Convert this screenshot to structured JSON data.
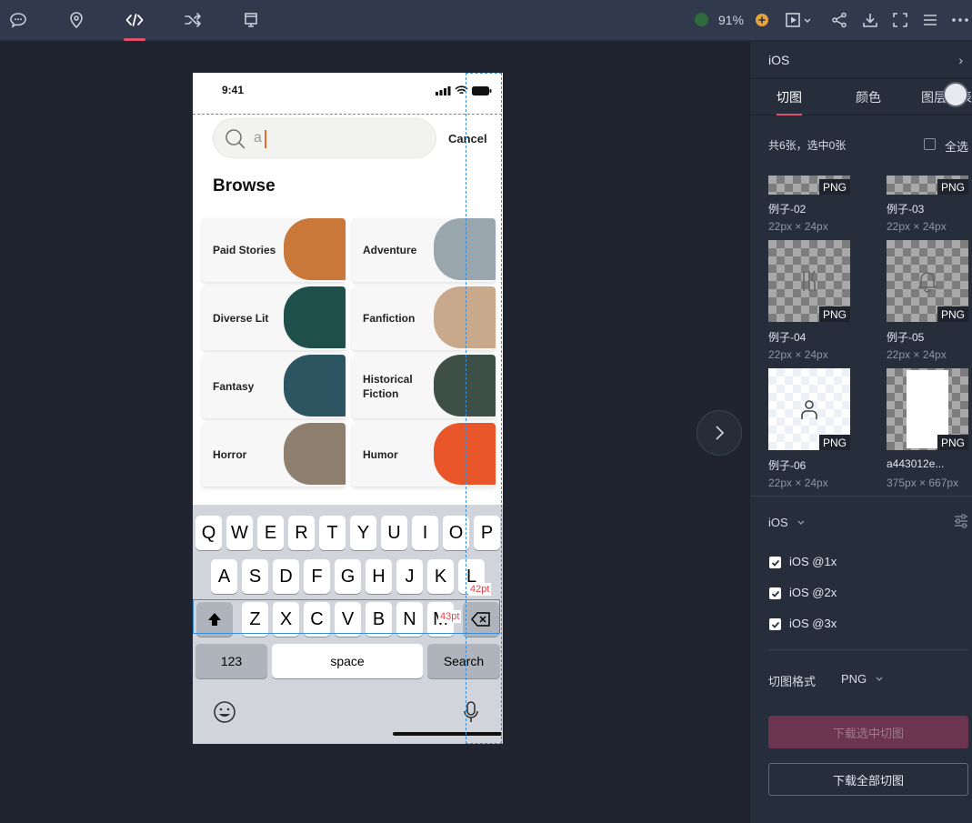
{
  "toolbar": {
    "icons": [
      "comment-icon",
      "location-pin-icon",
      "code-icon",
      "shuffle-icon",
      "frame-icon"
    ],
    "zoom": "91%",
    "right_icons": [
      "add-circle-icon",
      "play-icon",
      "share-icon",
      "download-icon",
      "fullscreen-icon",
      "menu-icon",
      "more-icon"
    ]
  },
  "phone": {
    "time": "9:41",
    "search_value": "a",
    "cancel": "Cancel",
    "heading": "Browse",
    "tiles": [
      {
        "label": "Paid Stories",
        "color": "#c9783a"
      },
      {
        "label": "Adventure",
        "color": "#9aa6ad"
      },
      {
        "label": "Diverse Lit",
        "color": "#1f4f4a"
      },
      {
        "label": "Fanfiction",
        "color": "#c9a98c"
      },
      {
        "label": "Fantasy",
        "color": "#2c5561"
      },
      {
        "label": "Historical Fiction",
        "color": "#3d4f47"
      },
      {
        "label": "Horror",
        "color": "#8d7e6e"
      },
      {
        "label": "Humor",
        "color": "#e8562a"
      }
    ],
    "keyboard": {
      "row1": [
        "Q",
        "W",
        "E",
        "R",
        "T",
        "Y",
        "U",
        "I",
        "O",
        "P"
      ],
      "row2": [
        "A",
        "S",
        "D",
        "F",
        "G",
        "H",
        "J",
        "K",
        "L"
      ],
      "row3": [
        "Z",
        "X",
        "C",
        "V",
        "B",
        "N",
        "M"
      ],
      "num": "123",
      "space": "space",
      "search": "Search"
    },
    "measure_height": "42pt",
    "measure_width": "43pt"
  },
  "panel": {
    "platform": "iOS",
    "tabs": [
      "切图",
      "颜色",
      "图层列表"
    ],
    "count_text": "共6张，选中0张",
    "select_all": "全选",
    "assets": [
      {
        "name": "例子-02",
        "size": "22px × 24px",
        "format": "PNG"
      },
      {
        "name": "例子-03",
        "size": "22px × 24px",
        "format": "PNG"
      },
      {
        "name": "例子-04",
        "size": "22px × 24px",
        "format": "PNG"
      },
      {
        "name": "例子-05",
        "size": "22px × 24px",
        "format": "PNG"
      },
      {
        "name": "例子-06",
        "size": "22px × 24px",
        "format": "PNG"
      },
      {
        "name": "a443012e...",
        "size": "375px × 667px",
        "format": "PNG"
      }
    ],
    "export_platform": "iOS",
    "scales": [
      "iOS @1x",
      "iOS @2x",
      "iOS @3x"
    ],
    "format_label": "切图格式",
    "format_value": "PNG",
    "download_selected": "下载选中切图",
    "download_all": "下载全部切图"
  }
}
